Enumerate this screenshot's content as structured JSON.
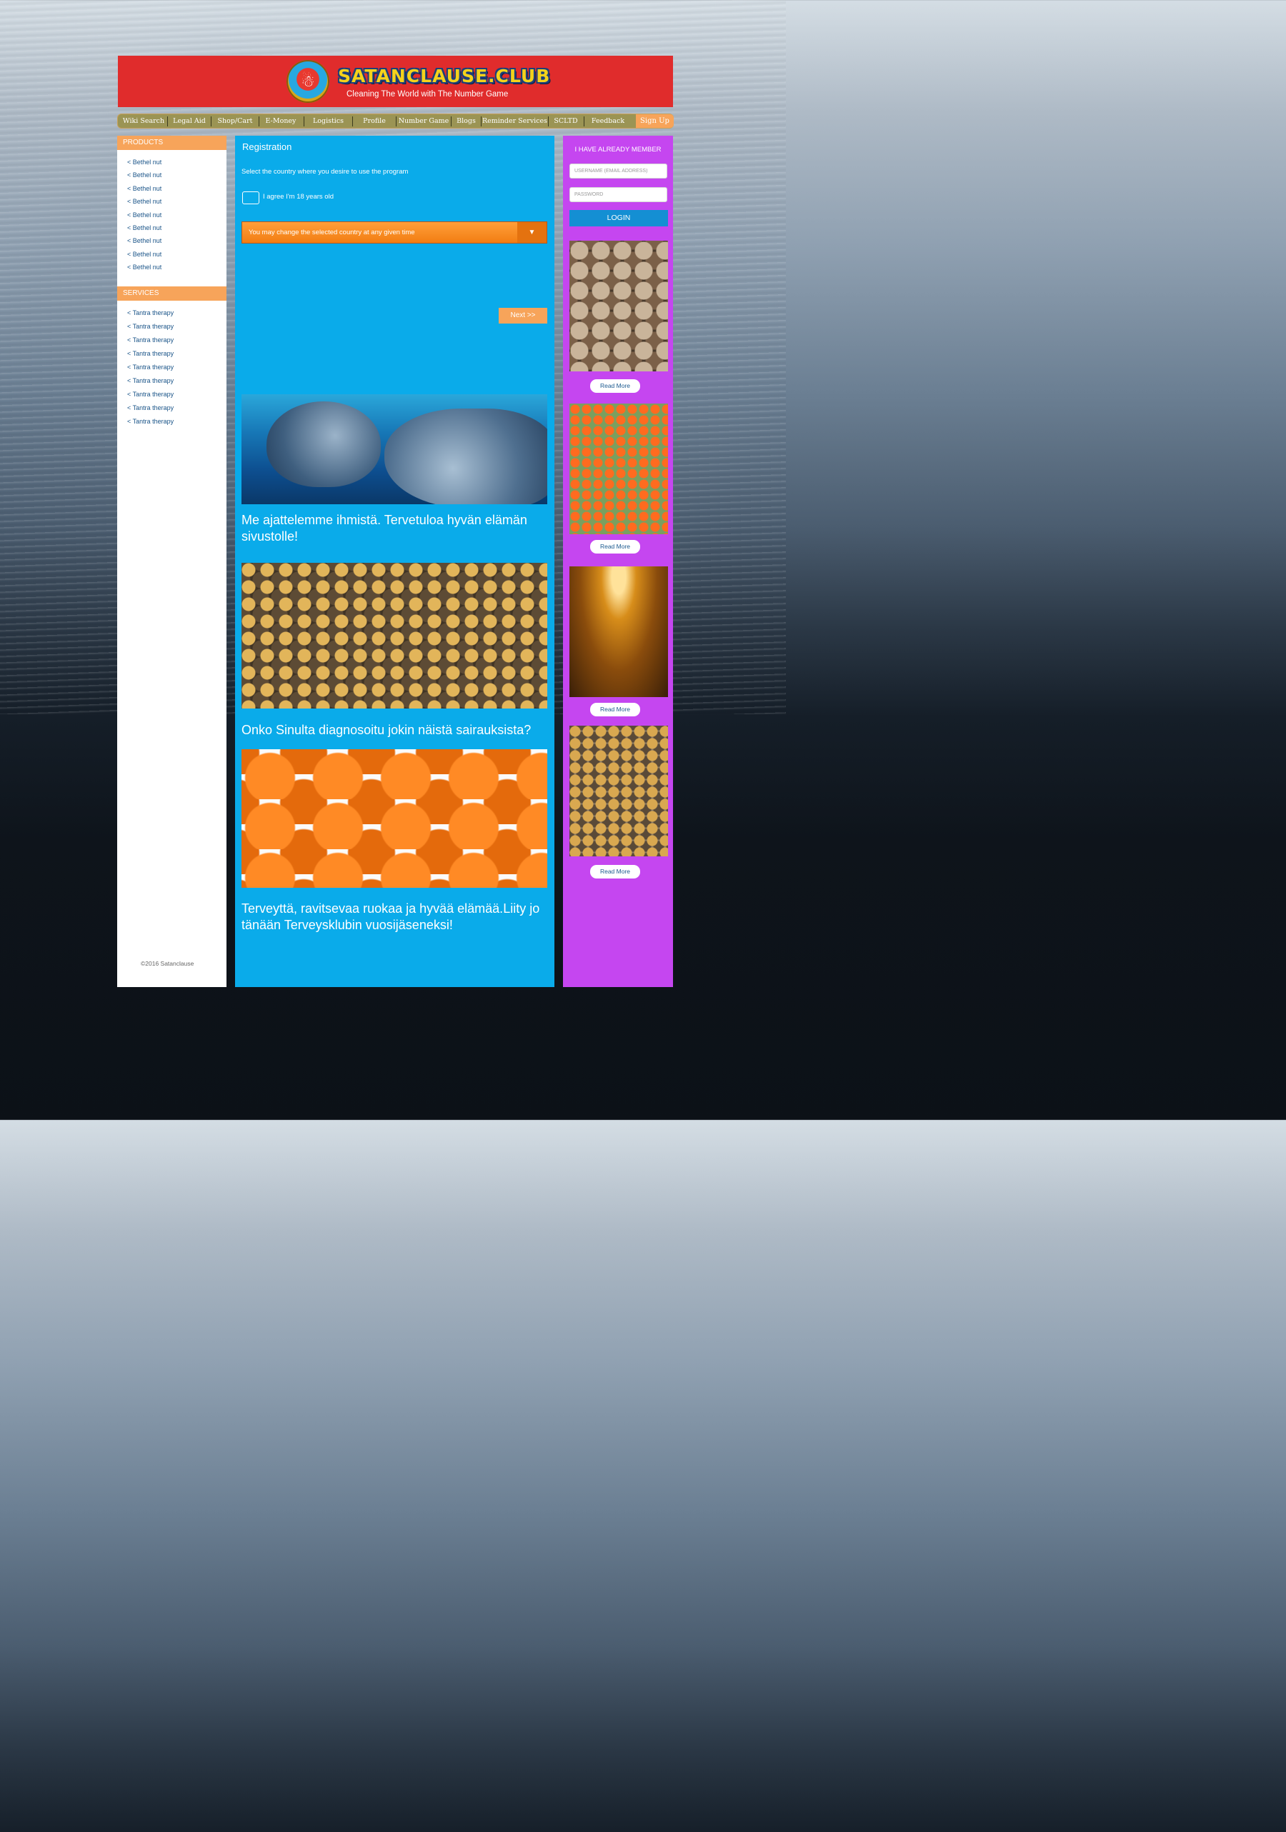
{
  "header": {
    "logo_badge_text": "☃",
    "site_name": "SATANCLAUSE.CLUB",
    "tagline": "Cleaning The World with The Number Game"
  },
  "nav": {
    "items": [
      "Wiki Search",
      "Legal Aid",
      "Shop/Cart",
      "E-Money",
      "Logistics",
      "Profile",
      "Number Game",
      "Blogs",
      "Reminder Services",
      "SCLTD",
      "Feedback"
    ],
    "signup": "Sign Up"
  },
  "sidebar": {
    "products_title": "PRODUCTS",
    "products": [
      "< Bethel nut",
      "< Bethel nut",
      "< Bethel nut",
      "< Bethel nut",
      "< Bethel nut",
      "< Bethel nut",
      "< Bethel nut",
      "< Bethel nut",
      "< Bethel nut"
    ],
    "services_title": "SERVICES",
    "services": [
      "< Tantra therapy",
      "< Tantra therapy",
      "< Tantra therapy",
      "< Tantra therapy",
      "< Tantra therapy",
      "< Tantra therapy",
      "< Tantra therapy",
      "< Tantra therapy",
      "< Tantra therapy"
    ],
    "copyright": "©2016 Satanclause"
  },
  "registration": {
    "title": "Registration",
    "description": "Select the country where you desire to use the program",
    "agree_label": "I agree I'm 18 years old",
    "country_select": "You may change the selected country at any given time",
    "next_button": "Next >>"
  },
  "articles": [
    {
      "text": "Me ajattelemme ihmistä. Tervetuloa hyvän elämän sivustolle!"
    },
    {
      "text": "Onko Sinulta diagnosoitu jokin näistä sairauksista?"
    },
    {
      "text": "Terveyttä, ravitsevaa ruokaa ja hyvää elämää.Liity jo tänään Terveysklubin vuosijäseneksi!"
    }
  ],
  "login": {
    "title": "I HAVE ALREADY MEMBER",
    "username_placeholder": "USERNAME (EMAIL ADDRESS)",
    "password_placeholder": "PASSWORD",
    "button": "LOGIN"
  },
  "promos": [
    {
      "button": "Read More"
    },
    {
      "button": "Read More"
    },
    {
      "button": "Read More"
    },
    {
      "button": "Read More"
    }
  ],
  "colors": {
    "header_red": "#e02c2c",
    "accent_orange": "#f7a45a",
    "main_blue": "#0aabea",
    "sidebar_purple": "#c546f0",
    "nav_olive": "#9b9454"
  }
}
